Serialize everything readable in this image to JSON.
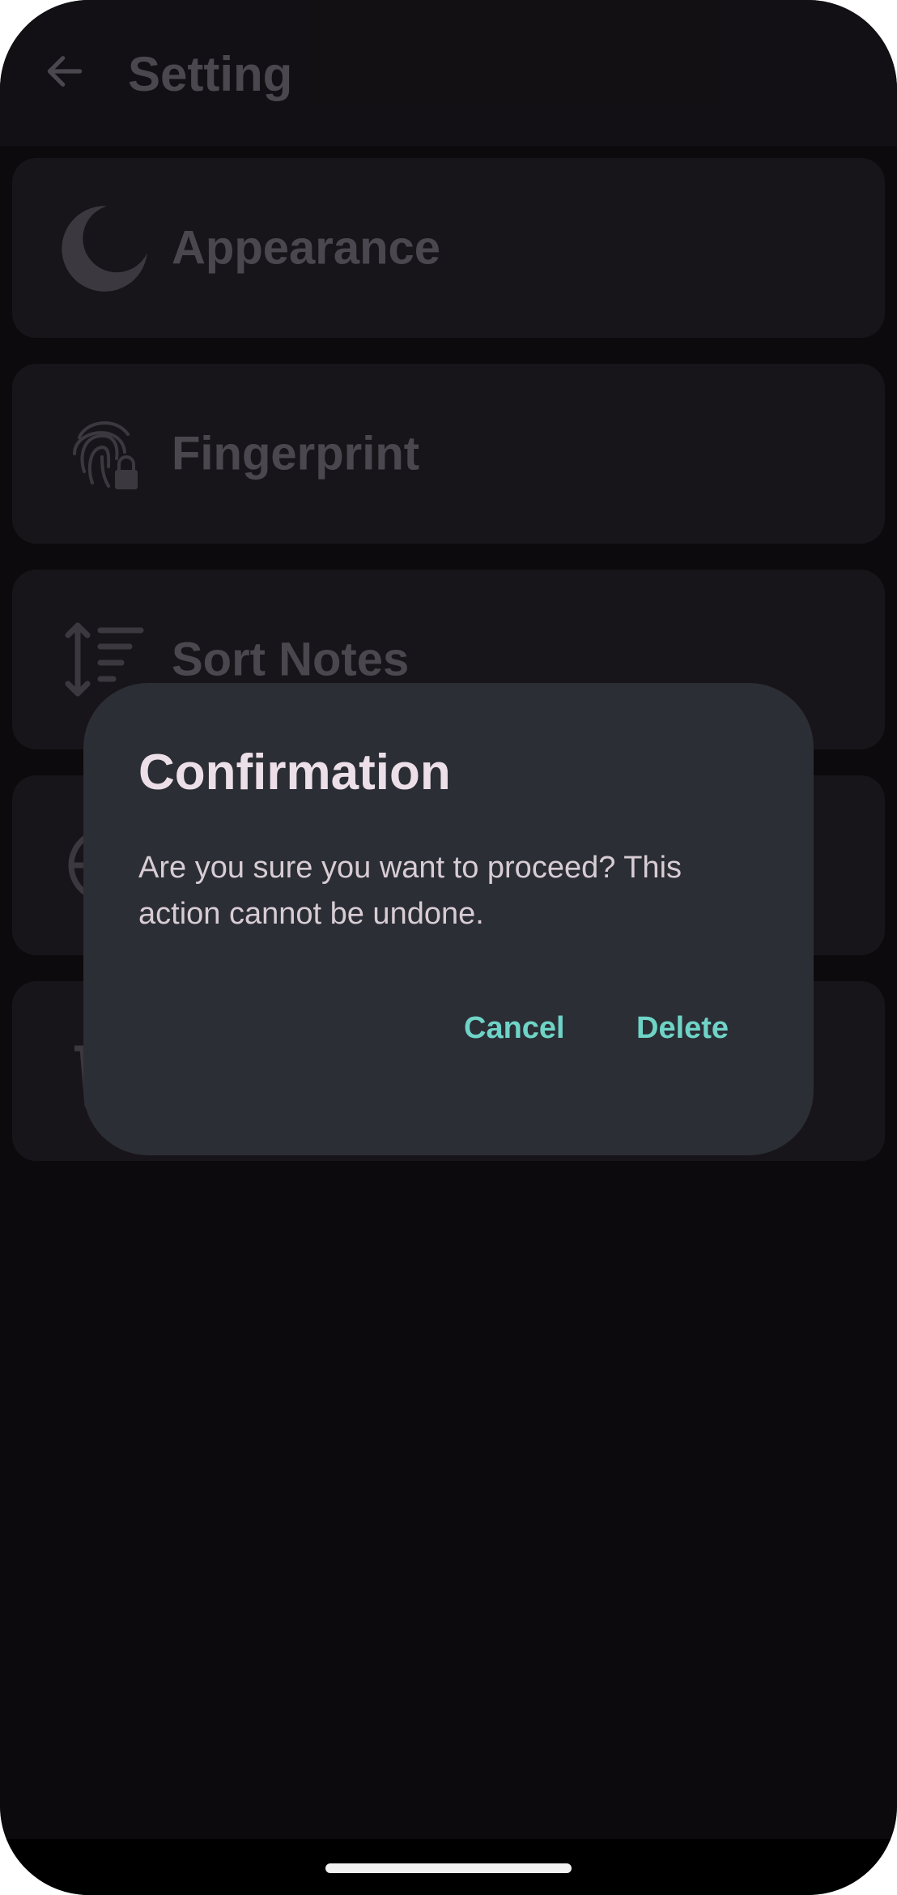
{
  "header": {
    "title": "Setting"
  },
  "settings": {
    "items": [
      {
        "label": "Appearance",
        "icon": "moon-icon"
      },
      {
        "label": "Fingerprint",
        "icon": "fingerprint-icon"
      },
      {
        "label": "Sort Notes",
        "icon": "sort-icon"
      },
      {
        "label": "",
        "icon": "globe-icon"
      },
      {
        "label": "",
        "icon": "trash-icon"
      }
    ]
  },
  "dialog": {
    "title": "Confirmation",
    "message": "Are you sure you want to proceed? This action cannot be undone.",
    "cancel_label": "Cancel",
    "delete_label": "Delete"
  },
  "colors": {
    "background": "#0e0c0f",
    "card": "#262229",
    "dialog": "#2b2e35",
    "accent": "#6fd4c7",
    "dimmed_text": "#8b8690"
  }
}
